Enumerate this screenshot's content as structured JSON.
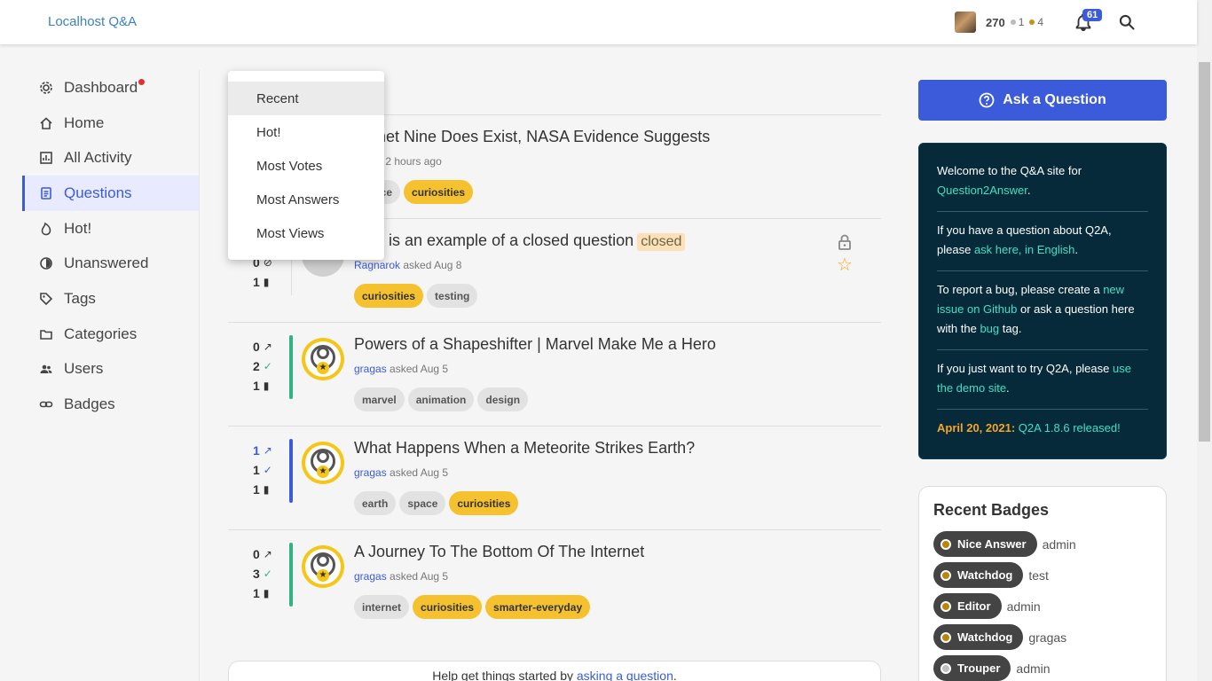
{
  "site": {
    "title": "Localhost Q&A"
  },
  "user": {
    "points": "270",
    "silver": "1",
    "bronze": "4",
    "notifications": "61"
  },
  "sidebar": {
    "items": [
      {
        "label": "Dashboard"
      },
      {
        "label": "Home"
      },
      {
        "label": "All Activity"
      },
      {
        "label": "Questions"
      },
      {
        "label": "Hot!"
      },
      {
        "label": "Unanswered"
      },
      {
        "label": "Tags"
      },
      {
        "label": "Categories"
      },
      {
        "label": "Users"
      },
      {
        "label": "Badges"
      }
    ]
  },
  "sort_menu": {
    "options": [
      "Recent",
      "Hot!",
      "Most Votes",
      "Most Answers",
      "Most Views"
    ]
  },
  "questions": [
    {
      "title": "Planet Nine Does Exist, NASA Evidence Suggests",
      "asker": "",
      "when": "asked 2 hours ago",
      "tags": [
        "space",
        "curiosities"
      ]
    },
    {
      "title": "This is an example of a closed question",
      "closed_label": "closed",
      "asker": "Ragnarok",
      "when": "asked Aug 8",
      "answers": "0",
      "views": "1",
      "tags": [
        "curiosities",
        "testing"
      ]
    },
    {
      "title": "Powers of a Shapeshifter | Marvel Make Me a Hero",
      "asker": "gragas",
      "when": "asked Aug 5",
      "votes": "0",
      "answers": "2",
      "views": "1",
      "tags": [
        "marvel",
        "animation",
        "design"
      ]
    },
    {
      "title": "What Happens When a Meteorite Strikes Earth?",
      "asker": "gragas",
      "when": "asked Aug 5",
      "votes": "1",
      "answers": "1",
      "views": "1",
      "tags": [
        "earth",
        "space",
        "curiosities"
      ]
    },
    {
      "title": "A Journey To The Bottom Of The Internet",
      "asker": "gragas",
      "when": "asked Aug 5",
      "votes": "0",
      "answers": "3",
      "views": "1",
      "tags": [
        "internet",
        "curiosities",
        "smarter-everyday"
      ]
    }
  ],
  "help": {
    "text": "Help get things started by",
    "link": "asking a question",
    "end": "."
  },
  "ask_button": {
    "label": "Ask a Question"
  },
  "welcome": {
    "p1": "Welcome to the Q&A site for",
    "p1_link": "Question2Answer",
    "p1_end": ".",
    "p2": "If you have a question about Q2A, please",
    "p2_link": "ask here, in English",
    "p2_end": ".",
    "p3": "To report a bug, please create a",
    "p3_link": "new issue on Github",
    "p3_mid": "or ask a question here with the",
    "p3_link2": "bug",
    "p3_end": "tag.",
    "p4": "If you just want to try Q2A, please",
    "p4_link": "use the demo site",
    "p4_end": ".",
    "p5_date": "April 20, 2021:",
    "p5_link": "Q2A 1.8.6 released!"
  },
  "recent_badges": {
    "title": "Recent Badges",
    "items": [
      {
        "badge": "Nice Answer",
        "user": "admin"
      },
      {
        "badge": "Watchdog",
        "user": "test"
      },
      {
        "badge": "Editor",
        "user": "admin"
      },
      {
        "badge": "Watchdog",
        "user": "gragas"
      },
      {
        "badge": "Trouper",
        "user": "admin"
      }
    ]
  }
}
